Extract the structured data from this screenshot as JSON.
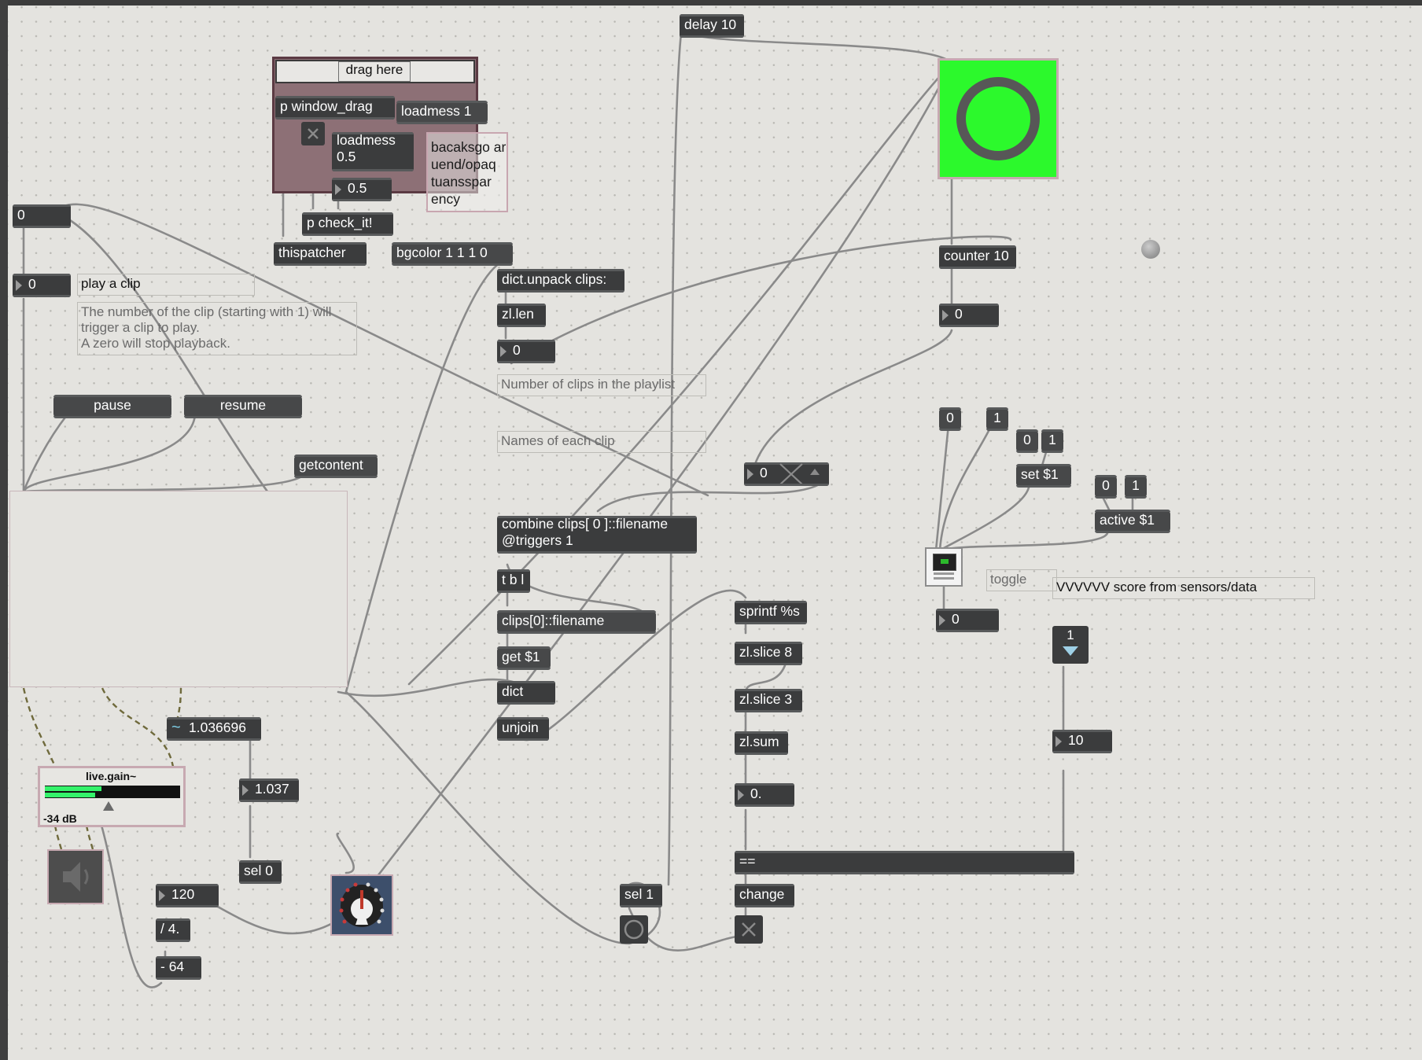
{
  "objects": {
    "drag_here": "drag here",
    "p_window_drag": "p window_drag",
    "loadmess_1": "loadmess 1",
    "loadmess_05": "loadmess\n0.5",
    "num_05": "0.5",
    "p_check_it": "p check_it!",
    "thispatcher": "thispatcher",
    "bgcolor": "bgcolor 1 1 1 0",
    "background_overlap": "backgrou\ntransparency",
    "background_overlap_a": "bacaksgo ar",
    "background_overlap_b": "uend/opaq",
    "background_overlap_c": "tuansspar",
    "background_overlap_d": "ency",
    "delay": "delay 10",
    "counter": "counter 10",
    "num_counter": "0",
    "dict_unpack": "dict.unpack clips:",
    "zl_len": "zl.len",
    "num_len": "0",
    "combine": "combine clips[ 0 ]::filename @triggers 1",
    "tbl": "t b l",
    "clips_filename": "clips[0]::filename",
    "get": "get $1",
    "dict": "dict",
    "unjoin": "unjoin",
    "sprintf": "sprintf %s",
    "zl_slice8": "zl.slice 8",
    "zl_slice3": "zl.slice 3",
    "zl_sum": "zl.sum",
    "num_sum": "0.",
    "equals": "==",
    "change": "change",
    "sel1": "sel 1",
    "sel0": "sel 0",
    "num_play": "0",
    "num_top": "0",
    "pause": "pause",
    "resume": "resume",
    "getcontent": "getcontent",
    "sig_value": "1.036696",
    "num_1037": "1.037",
    "num_120": "120",
    "div4": "/ 4.",
    "minus64": "- 64",
    "gain_label": "live.gain~",
    "gain_db": "-34 dB",
    "num_x": "0",
    "msg_0a": "0",
    "msg_1a": "1",
    "msg_0b": "0",
    "msg_1b": "1",
    "set1": "set $1",
    "msg_0c": "0",
    "msg_1c": "1",
    "active1": "active $1",
    "num_toggle_out": "0",
    "num_10": "10",
    "slider_val": "1"
  },
  "comments": {
    "play_a_clip": "play a clip",
    "clip_help": "The number of the clip (starting with 1) will trigger a clip to play.\nA zero will stop playback.",
    "num_clips": "Number of clips in the playlist",
    "names_each": "Names of each clip",
    "toggle": "toggle",
    "score": "VVVVVV score from sensors/data"
  },
  "colors": {
    "canvas": "#e4e3df",
    "object": "#3b3c3d",
    "button_green": "#2cf92c",
    "cable": "#8e8e8e"
  }
}
